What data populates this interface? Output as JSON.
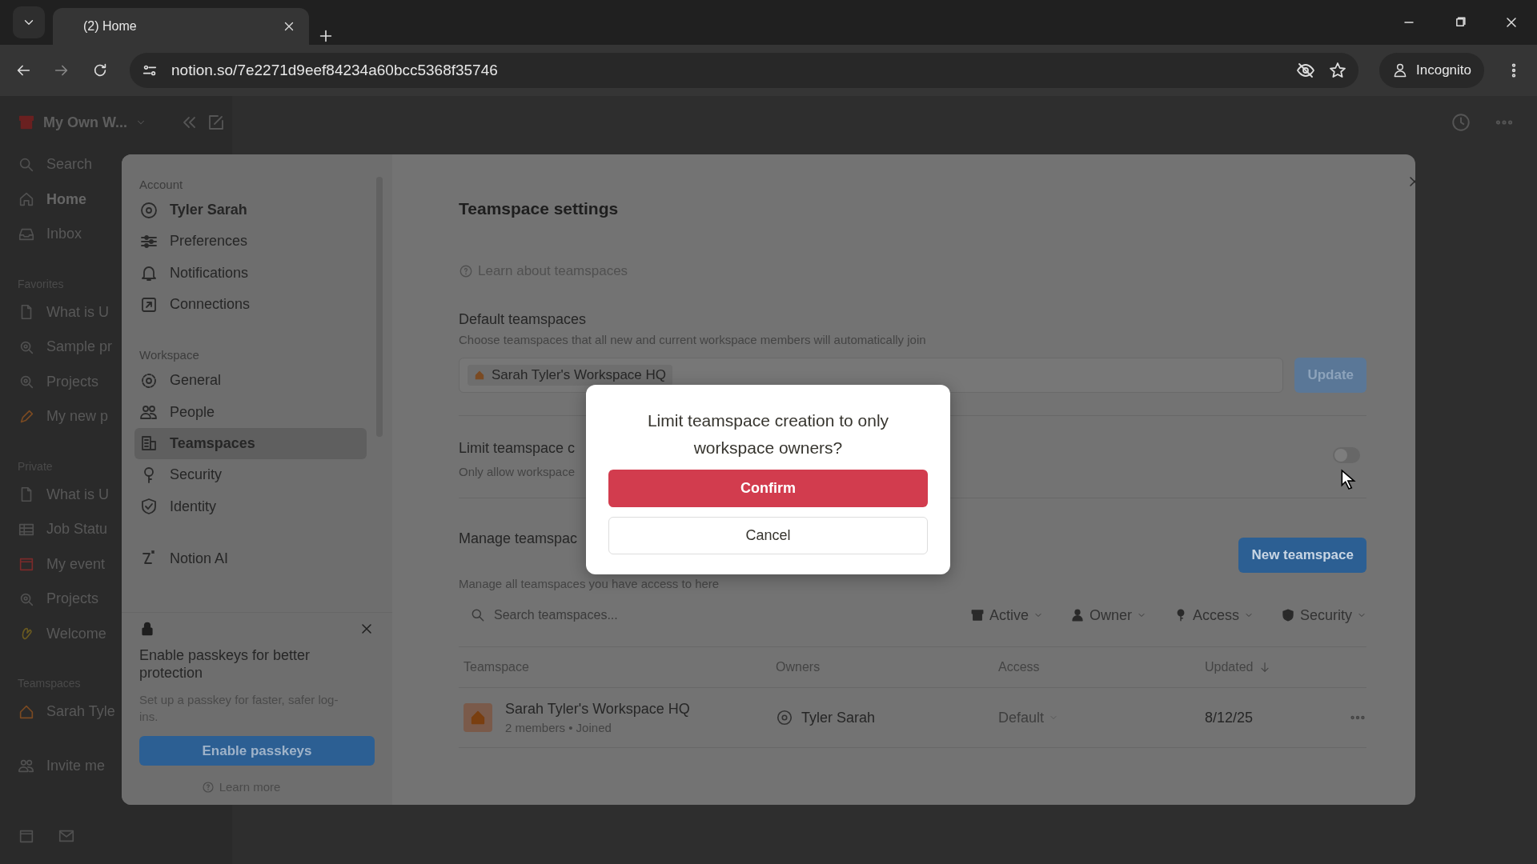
{
  "browser": {
    "tab": {
      "title": "(2) Home",
      "selected": true
    },
    "url": "notion.so/7e2271d9eef84234a60bcc5368f35746",
    "profile": "Incognito"
  },
  "sidebar": {
    "workspace": "My Own W...",
    "top": [
      {
        "label": "Search",
        "kind": "search",
        "selected": false
      },
      {
        "label": "Home",
        "kind": "home",
        "selected": true
      },
      {
        "label": "Inbox",
        "kind": "inbox",
        "selected": false
      }
    ],
    "sections": [
      {
        "title": "Favorites",
        "items": [
          {
            "label": "What is U",
            "kind": "page"
          },
          {
            "label": "Sample pr",
            "kind": "search-page"
          },
          {
            "label": "Projects",
            "kind": "search-page"
          },
          {
            "label": "My new p",
            "kind": "pencil"
          }
        ]
      },
      {
        "title": "Private",
        "items": [
          {
            "label": "What is U",
            "kind": "page"
          },
          {
            "label": "Job Statu",
            "kind": "table"
          },
          {
            "label": "My event",
            "kind": "calendar"
          },
          {
            "label": "Projects",
            "kind": "search-page"
          },
          {
            "label": "Welcome",
            "kind": "wave"
          }
        ]
      },
      {
        "title": "Teamspaces",
        "items": [
          {
            "label": "Sarah Tyle",
            "kind": "house"
          }
        ]
      }
    ],
    "invite": "Invite me"
  },
  "settings": {
    "nav": [
      {
        "title": "Account",
        "items": [
          {
            "label": "Tyler Sarah",
            "kind": "avatar",
            "selected": false
          },
          {
            "label": "Preferences",
            "kind": "sliders",
            "selected": false
          },
          {
            "label": "Notifications",
            "kind": "bell",
            "selected": false
          },
          {
            "label": "Connections",
            "kind": "link",
            "selected": false
          }
        ]
      },
      {
        "title": "Workspace",
        "items": [
          {
            "label": "General",
            "kind": "gear",
            "selected": false
          },
          {
            "label": "People",
            "kind": "people",
            "selected": false
          },
          {
            "label": "Teamspaces",
            "kind": "building",
            "selected": true
          },
          {
            "label": "Security",
            "kind": "key",
            "selected": false
          },
          {
            "label": "Identity",
            "kind": "shield",
            "selected": false
          }
        ]
      },
      {
        "items": [
          {
            "label": "Notion AI",
            "kind": "ai",
            "selected": false
          }
        ]
      }
    ],
    "passkey_card": {
      "title": "Enable passkeys for better protection",
      "description": "Set up a passkey for faster, safer log-ins.",
      "button": "Enable passkeys",
      "link": "Learn more"
    },
    "title": "Teamspace settings",
    "learn_link": "Learn about teamspaces",
    "default_teamspaces": {
      "title": "Default teamspaces",
      "description": "Choose teamspaces that all new and current workspace members will automatically join",
      "chip": "Sarah Tyler's Workspace HQ",
      "button": {
        "label": "Update",
        "disabled": true
      }
    },
    "limit": {
      "title": "Limit teamspace c",
      "description": "Only allow workspace",
      "on": false
    },
    "manage": {
      "title": "Manage teamspac",
      "description": "Manage all teamspaces you have access to here",
      "button": "New teamspace"
    },
    "search": {
      "placeholder": "Search teamspaces..."
    },
    "filters": [
      {
        "label": "Active",
        "kind": "archive"
      },
      {
        "label": "Owner",
        "kind": "person"
      },
      {
        "label": "Access",
        "kind": "key"
      },
      {
        "label": "Security",
        "kind": "shield"
      }
    ],
    "columns": [
      {
        "label": "Teamspace",
        "sorted": false
      },
      {
        "label": "Owners",
        "sorted": false
      },
      {
        "label": "Access",
        "sorted": false
      },
      {
        "label": "Updated",
        "sorted": true
      }
    ],
    "rows": [
      {
        "name": "Sarah Tyler's Workspace HQ",
        "meta": "2 members • Joined",
        "owner": "Tyler Sarah",
        "access": "Default",
        "updated": "8/12/25"
      }
    ]
  },
  "dialog": {
    "title": "Limit teamspace creation to only workspace owners?",
    "confirm": "Confirm",
    "cancel": "Cancel"
  }
}
